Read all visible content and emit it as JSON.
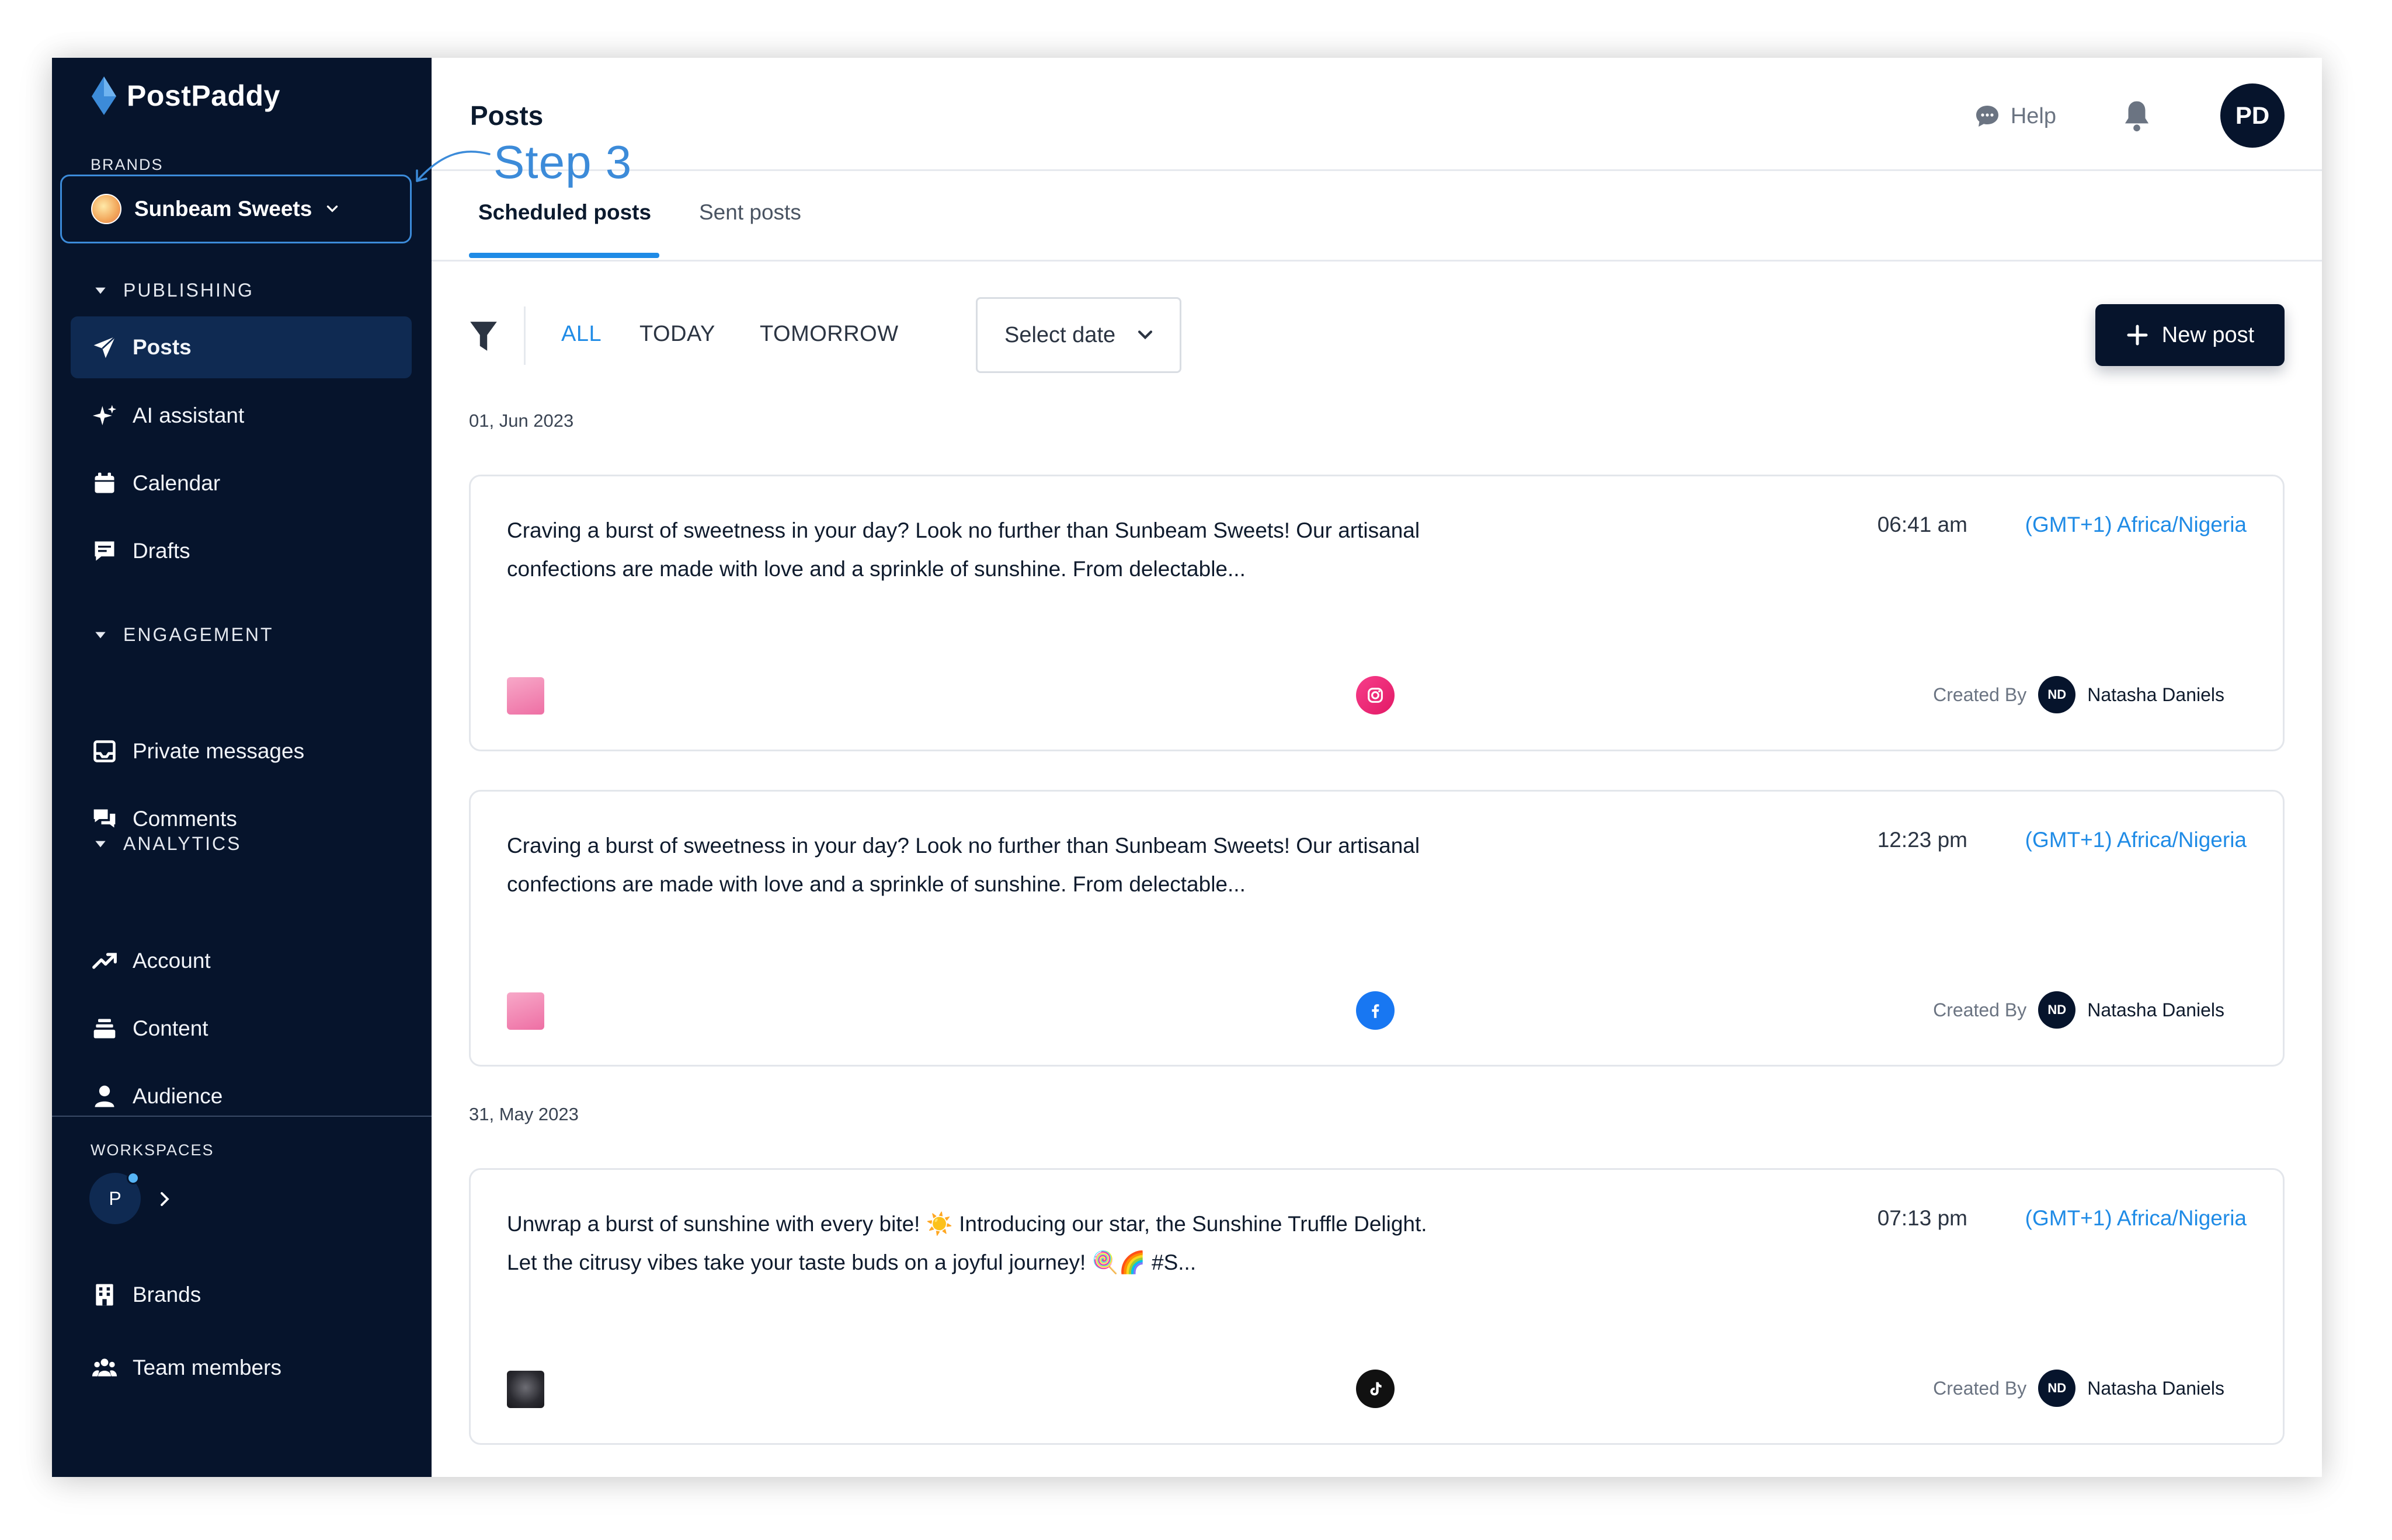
{
  "app": {
    "name": "PostPaddy"
  },
  "sidebar": {
    "brands_caption": "BRANDS",
    "brand_name": "Sunbeam Sweets",
    "sections": {
      "publishing": "PUBLISHING",
      "engagement": "ENGAGEMENT",
      "analytics": "ANALYTICS"
    },
    "items": {
      "posts": "Posts",
      "ai_assistant": "AI assistant",
      "calendar": "Calendar",
      "drafts": "Drafts",
      "private_messages": "Private messages",
      "comments": "Comments",
      "account": "Account",
      "content": "Content",
      "audience": "Audience",
      "brands": "Brands",
      "team_members": "Team members"
    },
    "workspaces_caption": "WORKSPACES",
    "workspace_initial": "P"
  },
  "header": {
    "title": "Posts",
    "help": "Help",
    "user_initials": "PD"
  },
  "tabs": {
    "scheduled": "Scheduled posts",
    "sent": "Sent posts"
  },
  "filters": {
    "all": "ALL",
    "today": "TODAY",
    "tomorrow": "TOMORROW",
    "date_select": "Select date",
    "new_post": "New post"
  },
  "groups": [
    {
      "date": "01, Jun 2023",
      "posts": [
        {
          "text": "Craving a burst of sweetness in your day? Look no further than Sunbeam Sweets! Our artisanal confections are made with love and a sprinkle of sunshine. From delectable...",
          "time": "06:41 am",
          "timezone": "(GMT+1) Africa/Nigeria",
          "network": "instagram",
          "created_by_label": "Created By",
          "creator_initials": "ND",
          "creator": "Natasha Daniels"
        },
        {
          "text": "Craving a burst of sweetness in your day? Look no further than Sunbeam Sweets! Our artisanal confections are made with love and a sprinkle of sunshine. From delectable...",
          "time": "12:23 pm",
          "timezone": "(GMT+1) Africa/Nigeria",
          "network": "facebook",
          "created_by_label": "Created By",
          "creator_initials": "ND",
          "creator": "Natasha Daniels"
        }
      ]
    },
    {
      "date": "31, May 2023",
      "posts": [
        {
          "text": "Unwrap a burst of sunshine with every bite! ☀️ Introducing our star, the Sunshine Truffle Delight. Let the citrusy vibes take your taste buds on a joyful journey! 🍭🌈 #S...",
          "time": "07:13 pm",
          "timezone": "(GMT+1) Africa/Nigeria",
          "network": "tiktok",
          "created_by_label": "Created By",
          "creator_initials": "ND",
          "creator": "Natasha Daniels"
        }
      ]
    }
  ],
  "annotation": {
    "step": "Step 3"
  },
  "colors": {
    "sidebar_bg": "#06142c",
    "accent_blue": "#1f8be6",
    "annotation_blue": "#3c8bd9"
  }
}
